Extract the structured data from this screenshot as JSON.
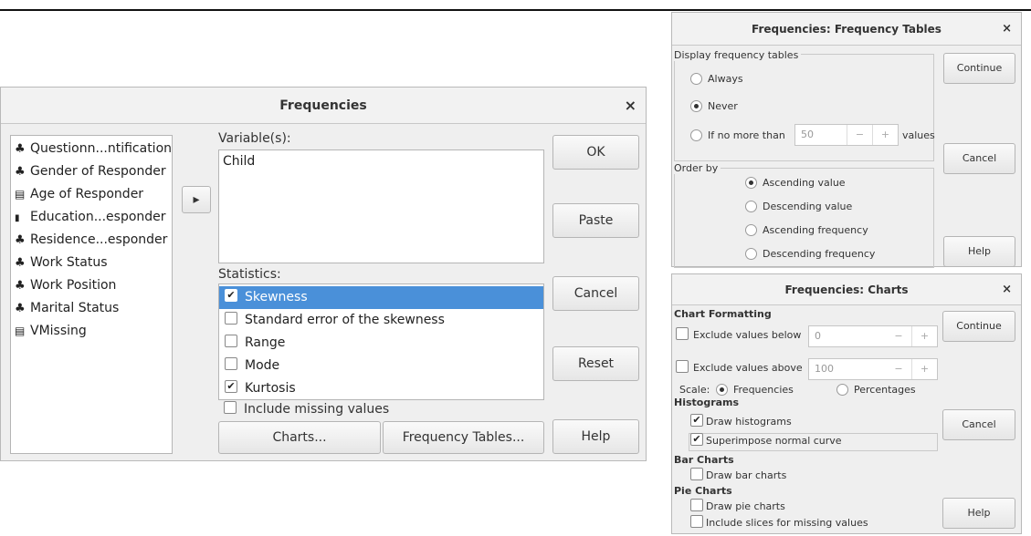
{
  "main": {
    "title": "Frequencies",
    "close": "×",
    "variables": [
      {
        "icon": "nominal-icon",
        "glyph": "♣",
        "label": "Questionn...ntification"
      },
      {
        "icon": "nominal-icon",
        "glyph": "♣",
        "label": "Gender of Responder"
      },
      {
        "icon": "scale-icon",
        "glyph": "▤",
        "label": "Age of Responder"
      },
      {
        "icon": "ordinal-icon",
        "glyph": "▮",
        "label": "Education...esponder"
      },
      {
        "icon": "nominal-string-icon",
        "glyph": "♣",
        "label": "Residence...esponder"
      },
      {
        "icon": "nominal-icon",
        "glyph": "♣",
        "label": "Work Status"
      },
      {
        "icon": "nominal-icon",
        "glyph": "♣",
        "label": "Work Position"
      },
      {
        "icon": "nominal-icon",
        "glyph": "♣",
        "label": "Marital Status"
      },
      {
        "icon": "scale-icon",
        "glyph": "▤",
        "label": "VMissing"
      }
    ],
    "move_arrow": "▸",
    "variables_label": "Variable(s):",
    "selected_variable": "Child",
    "statistics_label": "Statistics:",
    "statistics": [
      {
        "label": "Skewness",
        "checked": true,
        "selected": true
      },
      {
        "label": "Standard error of the skewness",
        "checked": false,
        "selected": false
      },
      {
        "label": "Range",
        "checked": false,
        "selected": false
      },
      {
        "label": "Mode",
        "checked": false,
        "selected": false
      },
      {
        "label": "Kurtosis",
        "checked": true,
        "selected": false
      }
    ],
    "include_missing": "Include missing values",
    "charts_btn": "Charts...",
    "freqtables_btn": "Frequency Tables...",
    "buttons": {
      "ok": "OK",
      "paste": "Paste",
      "cancel": "Cancel",
      "reset": "Reset",
      "help": "Help"
    }
  },
  "freq_tables": {
    "title": "Frequencies: Frequency Tables",
    "close": "×",
    "display_label": "Display frequency tables",
    "always": "Always",
    "never": "Never",
    "if_no_more": "If no more than",
    "limit_value": "50",
    "values_suffix": "values",
    "order_label": "Order by",
    "orders": [
      "Ascending value",
      "Descending value",
      "Ascending frequency",
      "Descending frequency"
    ],
    "continue": "Continue",
    "cancel": "Cancel",
    "help": "Help"
  },
  "charts": {
    "title": "Frequencies: Charts",
    "close": "×",
    "formatting_header": "Chart Formatting",
    "exclude_below": "Exclude values below",
    "below_value": "0",
    "exclude_above": "Exclude values above",
    "above_value": "100",
    "scale_label": "Scale:",
    "scale_freq": "Frequencies",
    "scale_pct": "Percentages",
    "histograms_header": "Histograms",
    "draw_histograms": "Draw histograms",
    "superimpose": "Superimpose normal curve",
    "bar_header": "Bar Charts",
    "draw_bar": "Draw bar charts",
    "pie_header": "Pie Charts",
    "draw_pie": "Draw pie charts",
    "include_slices": "Include slices for missing values",
    "continue": "Continue",
    "cancel": "Cancel",
    "help": "Help"
  },
  "spin_minus": "−",
  "spin_plus": "+"
}
